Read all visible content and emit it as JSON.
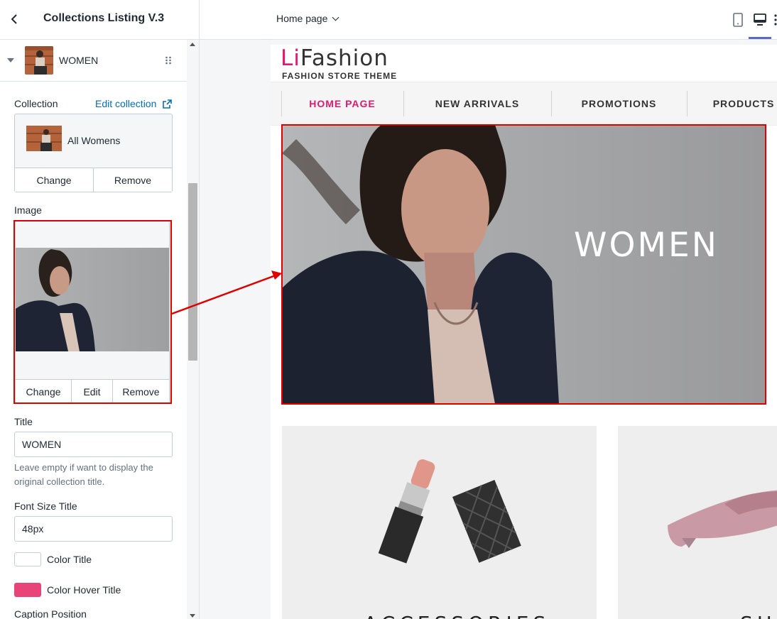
{
  "sidebar": {
    "header_title": "Collections Listing V.3",
    "block_label": "WOMEN",
    "collection": {
      "label": "Collection",
      "edit_link": "Edit collection",
      "name": "All Womens",
      "change": "Change",
      "remove": "Remove"
    },
    "image": {
      "label": "Image",
      "change": "Change",
      "edit": "Edit",
      "remove": "Remove"
    },
    "title": {
      "label": "Title",
      "value": "WOMEN",
      "help": "Leave empty if want to display the original collection title."
    },
    "font_size": {
      "label": "Font Size Title",
      "value": "48px"
    },
    "color_title": {
      "label": "Color Title",
      "color": "#ffffff"
    },
    "color_hover": {
      "label": "Color Hover Title",
      "color": "#e9447a"
    },
    "caption_label": "Caption Position"
  },
  "topbar": {
    "page_select": "Home page",
    "icons": [
      "mobile-icon",
      "desktop-icon",
      "more-icon"
    ]
  },
  "preview": {
    "logo_brand_pink": "Li",
    "logo_brand_rest": "Fashion",
    "logo_tagline": "FASHION STORE THEME",
    "nav": [
      "HOME PAGE",
      "NEW ARRIVALS",
      "PROMOTIONS",
      "PRODUCTS"
    ],
    "nav_active_color": "#e2196c",
    "hero_title": "WOMEN",
    "card_titles": [
      "ACCESSORIES",
      "SHOES"
    ]
  },
  "colors": {
    "accent": "#5c6ac4",
    "link": "#006fbb",
    "highlight_box": "#e00000"
  }
}
